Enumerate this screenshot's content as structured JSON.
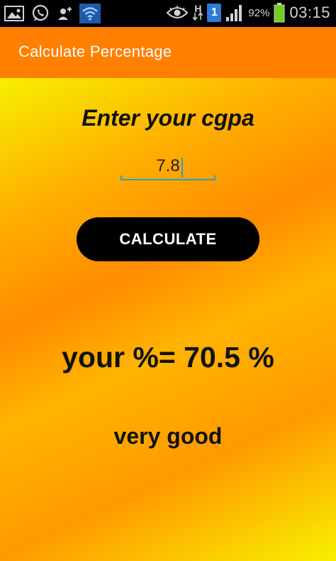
{
  "status_bar": {
    "icons_left": [
      "gallery-icon",
      "whatsapp-icon",
      "add-contact-icon",
      "wifi-icon"
    ],
    "icons_right": [
      "eye-icon",
      "h-network-icon",
      "notification-1-icon",
      "signal-icon",
      "battery-icon"
    ],
    "network_type": "H",
    "notification_count": "1",
    "battery_percent": "92%",
    "time": "03:15"
  },
  "app_bar": {
    "title": "Calculate Percentage",
    "color": "#ff7f00"
  },
  "main": {
    "prompt": "Enter your cgpa",
    "cgpa_value": "7.8",
    "calculate_label": "CALCULATE",
    "result": "your %= 70.5 %",
    "rating": "very good"
  }
}
